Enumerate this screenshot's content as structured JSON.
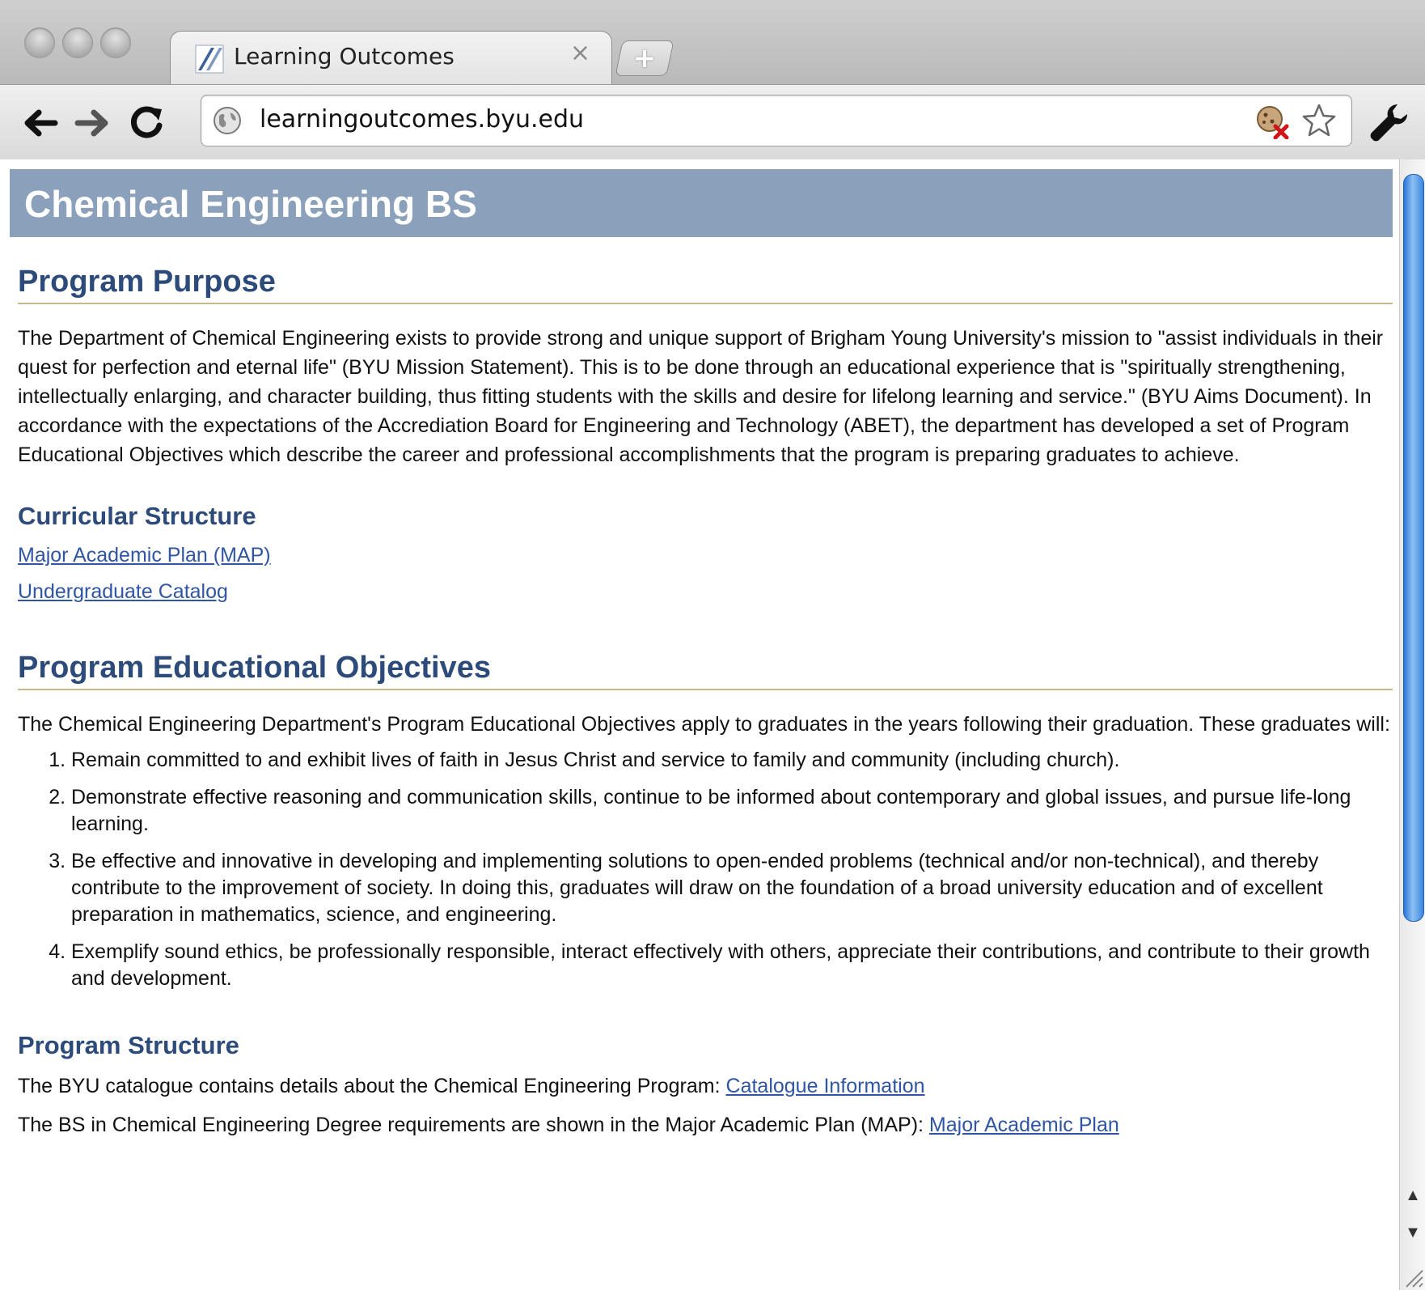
{
  "browser": {
    "tab_title": "Learning Outcomes",
    "tab_close": "×",
    "new_tab": "+",
    "url": "learningoutcomes.byu.edu"
  },
  "page": {
    "banner_title": "Chemical Engineering BS",
    "program_purpose": {
      "heading": "Program Purpose",
      "text": "The Department of Chemical Engineering exists to provide strong and unique support of Brigham Young University's mission to \"assist individuals in their quest for perfection and eternal life\" (BYU Mission Statement). This is to be done through an educational experience that is \"spiritually strengthening, intellectually enlarging, and character building, thus fitting students with the skills and desire for lifelong learning and service.\" (BYU Aims Document). In accordance with the expectations of the Accrediation Board for Engineering and Technology (ABET), the department has developed a set of Program Educational Objectives which describe the career and professional accomplishments that the program is preparing graduates to achieve."
    },
    "curricular_structure": {
      "heading": "Curricular Structure",
      "links": [
        "Major Academic Plan (MAP)",
        "Undergraduate Catalog"
      ]
    },
    "objectives": {
      "heading": "Program Educational Objectives",
      "intro": "The Chemical Engineering Department's Program Educational Objectives apply to graduates in the years following their graduation. These graduates will:",
      "items": [
        "Remain committed to and exhibit lives of faith in Jesus Christ and service to family and community (including church).",
        "Demonstrate effective reasoning and communication skills, continue to be informed about contemporary and global issues, and pursue life-long learning.",
        "Be effective and innovative in developing and implementing solutions to open-ended problems (technical and/or non-technical), and thereby contribute to the improvement of society. In doing this, graduates will draw on the foundation of a broad university education and of excellent preparation in mathematics, science, and engineering.",
        "Exemplify sound ethics, be professionally responsible, interact effectively with others, appreciate their contributions, and contribute to their growth and development."
      ]
    },
    "program_structure": {
      "heading": "Program Structure",
      "line1_text": "The BYU catalogue contains details about the Chemical Engineering Program: ",
      "line1_link": "Catalogue Information",
      "line2_text": "The BS in Chemical Engineering Degree requirements are shown in the Major Academic Plan (MAP): ",
      "line2_link": "Major Academic Plan"
    }
  },
  "icons": {
    "back": "back-arrow-icon",
    "forward": "forward-arrow-icon",
    "reload": "reload-icon",
    "globe": "globe-icon",
    "cookie_blocked": "cookie-blocked-icon",
    "bookmark": "star-icon",
    "settings": "wrench-icon"
  },
  "colors": {
    "banner": "#8ba0bb",
    "heading": "#2d4b7a",
    "rule": "#c9b98a",
    "link": "#2f55a4"
  }
}
